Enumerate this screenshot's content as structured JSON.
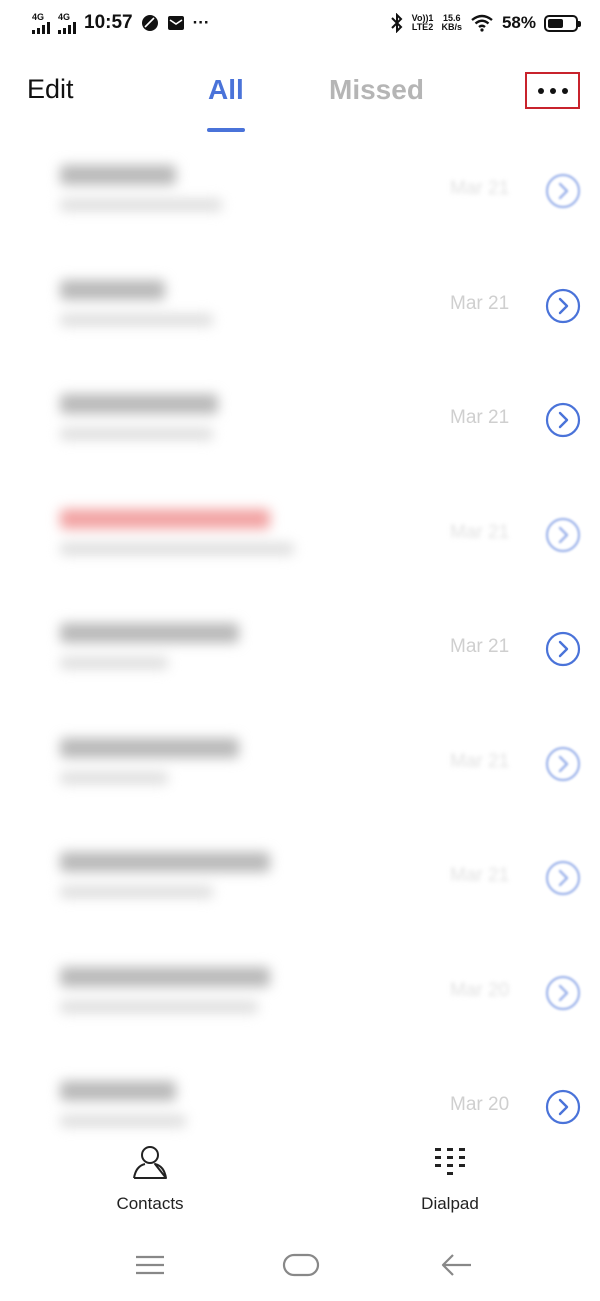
{
  "status_bar": {
    "net1": "4G",
    "net2": "4G",
    "time": "10:57",
    "more": "···",
    "volte_top": "Vo))1",
    "volte_bottom": "LTE2",
    "speed_top": "15.6",
    "speed_bottom": "KB/s",
    "battery_percent": "58%",
    "battery_level": 0.58
  },
  "top_bar": {
    "edit_label": "Edit",
    "tabs": [
      {
        "label": "All",
        "active": true
      },
      {
        "label": "Missed",
        "active": false
      }
    ],
    "more_icon": "more-horizontal-icon"
  },
  "calls": [
    {
      "date": "Mar 21",
      "name_len": 0.55,
      "sub_len": 0.9,
      "missed": false,
      "soft": true
    },
    {
      "date": "Mar 21",
      "name_len": 0.5,
      "sub_len": 0.85,
      "missed": false,
      "soft": false
    },
    {
      "date": "Mar 21",
      "name_len": 0.75,
      "sub_len": 0.85,
      "missed": false,
      "soft": false
    },
    {
      "date": "Mar 21",
      "name_len": 1.0,
      "sub_len": 1.3,
      "missed": true,
      "soft": true
    },
    {
      "date": "Mar 21",
      "name_len": 0.85,
      "sub_len": 0.6,
      "missed": false,
      "soft": false
    },
    {
      "date": "Mar 21",
      "name_len": 0.85,
      "sub_len": 0.6,
      "missed": false,
      "soft": true
    },
    {
      "date": "Mar 21",
      "name_len": 1.0,
      "sub_len": 0.85,
      "missed": false,
      "soft": true
    },
    {
      "date": "Mar 20",
      "name_len": 1.0,
      "sub_len": 1.1,
      "missed": false,
      "soft": true
    },
    {
      "date": "Mar 20",
      "name_len": 0.55,
      "sub_len": 0.7,
      "missed": false,
      "soft": false
    }
  ],
  "bottom_nav": {
    "contacts_label": "Contacts",
    "dialpad_label": "Dialpad"
  },
  "colors": {
    "accent": "#4a73d9",
    "highlight_box": "#c8232c",
    "inactive_tab": "#b5b5b5"
  }
}
